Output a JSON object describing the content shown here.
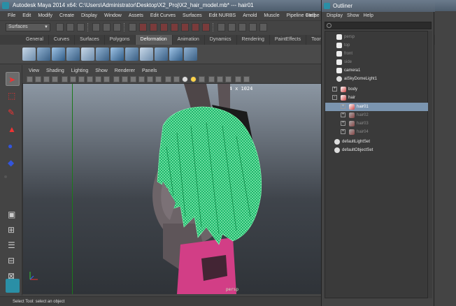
{
  "window": {
    "title": "Autodesk Maya 2014 x64: C:\\Users\\Administrator\\Desktop\\X2_Proj\\X2_hair_model.mb* --- hair01"
  },
  "menubar": [
    "File",
    "Edit",
    "Modify",
    "Create",
    "Display",
    "Window",
    "Assets",
    "Edit Curves",
    "Surfaces",
    "Edit NURBS",
    "Arnold",
    "Muscle",
    "Pipeline Cache",
    "Help"
  ],
  "statusline": {
    "mode": "Surfaces"
  },
  "shelf_tabs": [
    "General",
    "Curves",
    "Surfaces",
    "Polygons",
    "Deformation",
    "Animation",
    "Dynamics",
    "Rendering",
    "PaintEffects",
    "Toon",
    "stom"
  ],
  "shelf_active": "Deformation",
  "viewport_menu": [
    "View",
    "Shading",
    "Lighting",
    "Show",
    "Renderer",
    "Panels"
  ],
  "viewport": {
    "resolution": "1024 x 1024",
    "camera_label": "persp"
  },
  "helpline": "Select Tool: select an object",
  "outliner": {
    "title": "Outliner",
    "menu": [
      "Display",
      "Show",
      "Help"
    ],
    "items": [
      {
        "label": "persp",
        "dim": true,
        "icon": "camera-icon"
      },
      {
        "label": "top",
        "dim": true,
        "icon": "camera-icon"
      },
      {
        "label": "front",
        "dim": true,
        "icon": "camera-icon"
      },
      {
        "label": "side",
        "dim": true,
        "icon": "camera-icon"
      },
      {
        "label": "camera1",
        "dim": false,
        "icon": "camera-icon"
      },
      {
        "label": "aiSkyDomeLight1",
        "dim": false,
        "icon": "light-icon"
      },
      {
        "label": "body",
        "dim": false,
        "icon": "mesh-icon",
        "expander": "+"
      },
      {
        "label": "hair",
        "dim": false,
        "icon": "mesh-icon",
        "expander": "-"
      },
      {
        "label": "hair01",
        "dim": false,
        "icon": "mesh-icon",
        "expander": "+",
        "selected": true
      },
      {
        "label": "hair02",
        "dim": true,
        "icon": "mesh-icon",
        "expander": "+"
      },
      {
        "label": "hair03",
        "dim": true,
        "icon": "mesh-icon",
        "expander": "+"
      },
      {
        "label": "hair04",
        "dim": true,
        "icon": "mesh-icon",
        "expander": "+"
      },
      {
        "label": "defaultLightSet",
        "dim": false,
        "icon": "set-icon"
      },
      {
        "label": "defaultObjectSet",
        "dim": false,
        "icon": "set-icon"
      }
    ]
  }
}
